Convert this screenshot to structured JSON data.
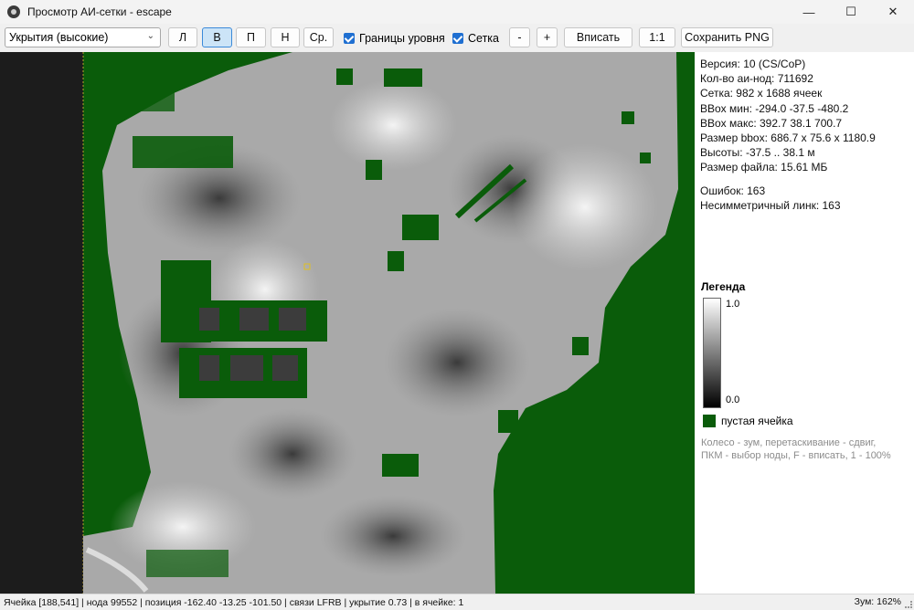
{
  "window": {
    "title": "Просмотр АИ-сетки - escape",
    "minimize": "—",
    "maximize": "☐",
    "close": "✕"
  },
  "toolbar": {
    "layer_select": "Укрытия (высокие)",
    "btn_l": "Л",
    "btn_v": "В",
    "btn_p": "П",
    "btn_n": "Н",
    "btn_avg": "Ср.",
    "chk_bounds": "Границы уровня",
    "chk_grid": "Сетка",
    "zoom_out": "-",
    "zoom_in": "+",
    "fit": "Вписать",
    "one_to_one": "1:1",
    "save_png": "Сохранить PNG"
  },
  "info": {
    "version": "Версия: 10 (CS/CoP)",
    "node_count": "Кол-во аи-нод: 711692",
    "grid": "Сетка: 982 x 1688 ячеек",
    "bbox_min": "BBox мин: -294.0 -37.5 -480.2",
    "bbox_max": "BBox макс: 392.7 38.1 700.7",
    "bbox_size": "Размер bbox: 686.7 x 75.6 x 1180.9",
    "heights": "Высоты: -37.5 .. 38.1 м",
    "file_size": "Размер файла: 15.61 МБ",
    "errors": "Ошибок: 163",
    "asym_links": "Несимметричный линк:  163"
  },
  "legend": {
    "title": "Легенда",
    "max": "1.0",
    "min": "0.0",
    "empty": "пустая ячейка",
    "hint_1": "Колесо - зум, перетаскивание - сдвиг,",
    "hint_2": "ПКМ - выбор ноды, F - вписать, 1 - 100%"
  },
  "status": {
    "text": "Ячейка [188,541]  |  нода 99552  |  позиция -162.40 -13.25 -101.50  |  связи LFRB  |  укрытие 0.73  |  в ячейке: 1",
    "zoom": "Зум: 162%"
  },
  "colors": {
    "empty_cell": "#0a5c0a",
    "accent": "#1f6fd1",
    "active_button": "#cce4f7"
  }
}
